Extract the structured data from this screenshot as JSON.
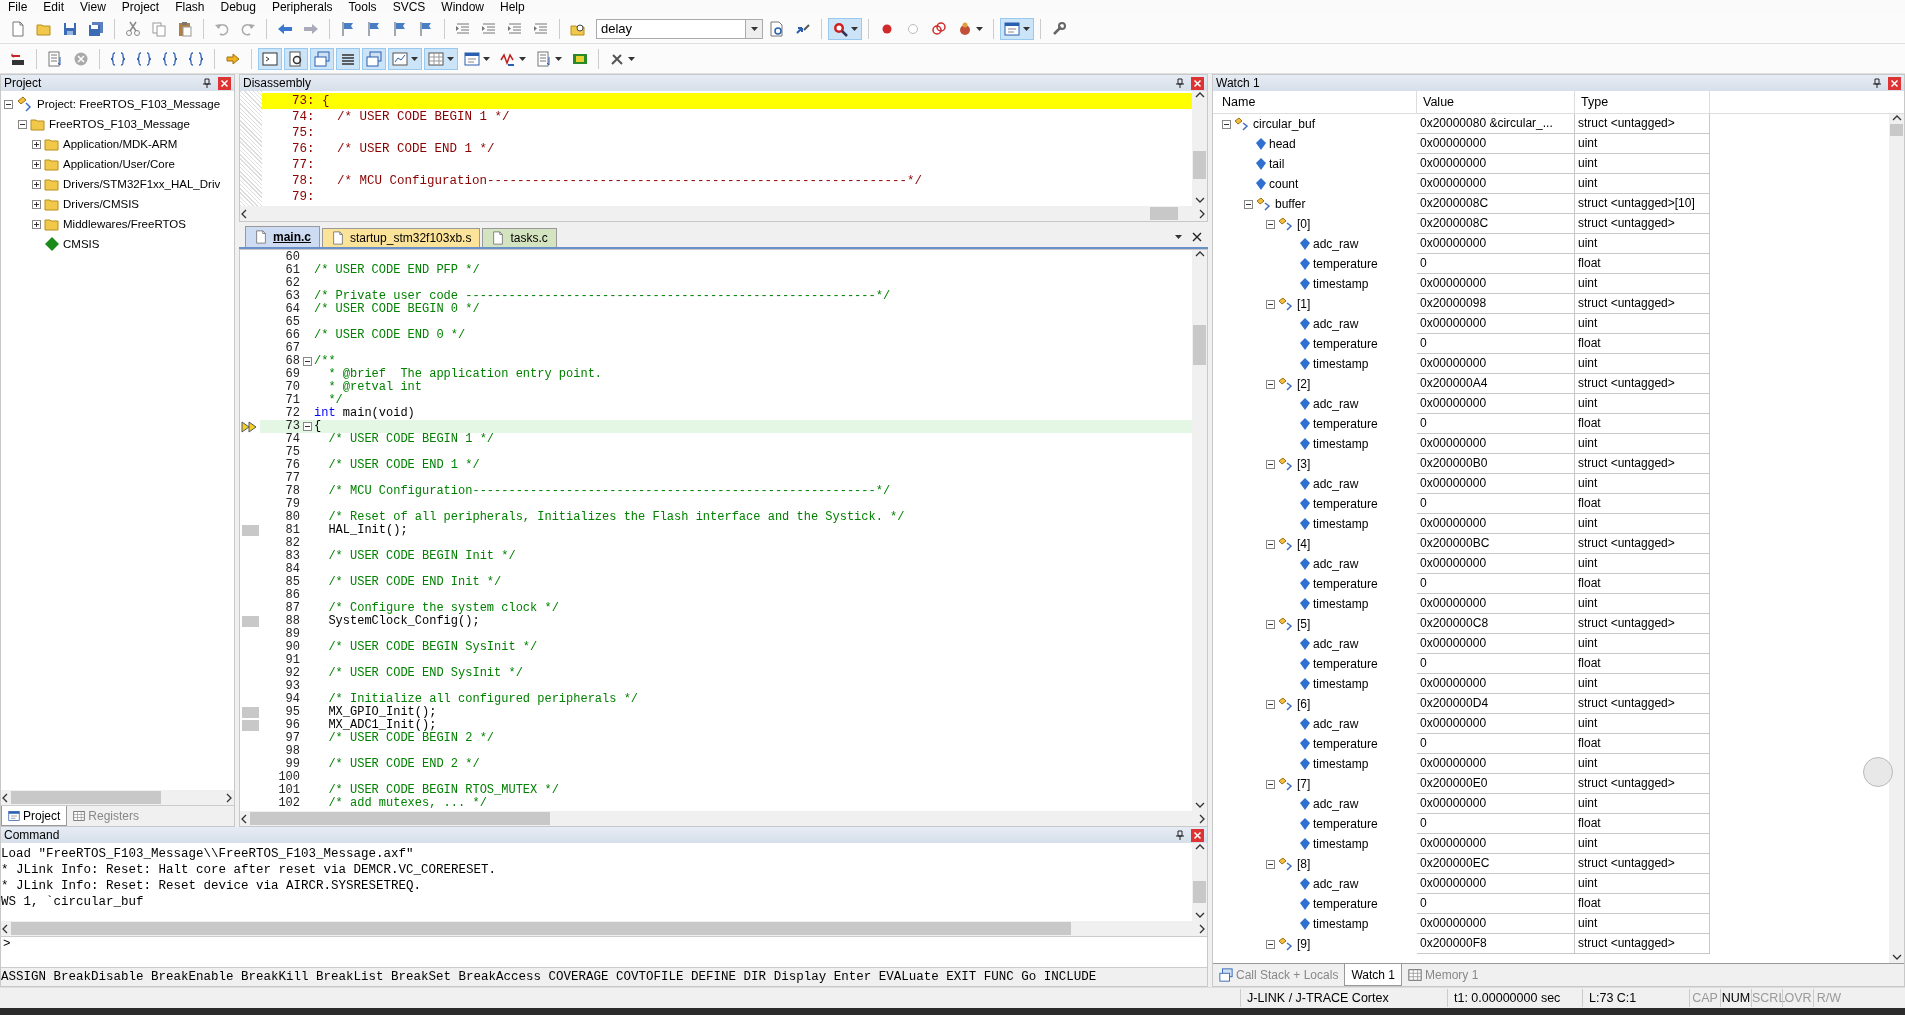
{
  "menu": [
    "File",
    "Edit",
    "View",
    "Project",
    "Flash",
    "Debug",
    "Peripherals",
    "Tools",
    "SVCS",
    "Window",
    "Help"
  ],
  "toolbar_1": [
    {
      "kind": "button",
      "on": false
    },
    {
      "kind": "button",
      "on": false
    },
    {
      "kind": "button",
      "on": false
    },
    {
      "kind": "button",
      "on": false
    },
    {
      "kind": "separator"
    },
    {
      "kind": "button",
      "on": false
    },
    {
      "kind": "button",
      "on": false
    },
    {
      "kind": "button",
      "on": false
    },
    {
      "kind": "separator"
    },
    {
      "kind": "button",
      "on": false
    },
    {
      "kind": "button",
      "on": false
    },
    {
      "kind": "separator"
    },
    {
      "kind": "button",
      "on": false
    },
    {
      "kind": "button",
      "on": false
    },
    {
      "kind": "separator"
    },
    {
      "kind": "button",
      "on": false
    },
    {
      "kind": "button",
      "on": false
    },
    {
      "kind": "button",
      "on": false
    },
    {
      "kind": "button",
      "on": false
    },
    {
      "kind": "separator"
    },
    {
      "kind": "button",
      "on": false
    },
    {
      "kind": "button",
      "on": false
    },
    {
      "kind": "button",
      "on": false
    },
    {
      "kind": "button",
      "on": false
    },
    {
      "kind": "separator"
    },
    {
      "kind": "button",
      "on": false
    },
    {
      "kind": "combo",
      "value": "delay"
    },
    {
      "kind": "button",
      "on": false
    },
    {
      "kind": "button",
      "on": false
    },
    {
      "kind": "separator"
    },
    {
      "kind": "menu-button",
      "on": true
    },
    {
      "kind": "separator"
    },
    {
      "kind": "button",
      "on": false
    },
    {
      "kind": "button",
      "on": false
    },
    {
      "kind": "button",
      "on": false
    },
    {
      "kind": "menu-button",
      "on": false
    },
    {
      "kind": "separator"
    },
    {
      "kind": "menu-button",
      "on": true
    },
    {
      "kind": "separator"
    },
    {
      "kind": "button",
      "on": false
    }
  ],
  "toolbar_2": [
    {
      "kind": "button",
      "on": false
    },
    {
      "kind": "separator"
    },
    {
      "kind": "button",
      "on": false
    },
    {
      "kind": "button",
      "on": false
    },
    {
      "kind": "separator"
    },
    {
      "kind": "button",
      "on": false
    },
    {
      "kind": "button",
      "on": false
    },
    {
      "kind": "button",
      "on": false
    },
    {
      "kind": "button",
      "on": false
    },
    {
      "kind": "separator"
    },
    {
      "kind": "button",
      "on": false
    },
    {
      "kind": "separator"
    },
    {
      "kind": "button",
      "on": true
    },
    {
      "kind": "button",
      "on": true
    },
    {
      "kind": "button",
      "on": true
    },
    {
      "kind": "button",
      "on": true
    },
    {
      "kind": "button",
      "on": true
    },
    {
      "kind": "menu-button",
      "on": true
    },
    {
      "kind": "menu-button",
      "on": true
    },
    {
      "kind": "menu-button",
      "on": false
    },
    {
      "kind": "menu-button",
      "on": false
    },
    {
      "kind": "menu-button",
      "on": false
    },
    {
      "kind": "button",
      "on": false
    },
    {
      "kind": "separator"
    },
    {
      "kind": "menu-button",
      "on": false
    }
  ],
  "project_panel": {
    "title": "Project",
    "tree": [
      {
        "label": "Project: FreeRTOS_F103_Message",
        "kind": "project",
        "expanded": true,
        "children": [
          {
            "label": "FreeRTOS_F103_Message",
            "kind": "target",
            "expanded": true,
            "children": [
              {
                "label": "Application/MDK-ARM",
                "kind": "folder",
                "expanded": false
              },
              {
                "label": "Application/User/Core",
                "kind": "folder",
                "expanded": false
              },
              {
                "label": "Drivers/STM32F1xx_HAL_Driv",
                "kind": "folder",
                "expanded": false
              },
              {
                "label": "Drivers/CMSIS",
                "kind": "folder",
                "expanded": false
              },
              {
                "label": "Middlewares/FreeRTOS",
                "kind": "folder",
                "expanded": false
              },
              {
                "label": "CMSIS",
                "kind": "component"
              }
            ]
          }
        ]
      }
    ],
    "tabs": [
      {
        "label": "Project",
        "selected": true
      },
      {
        "label": "Registers",
        "selected": false
      }
    ]
  },
  "disassembly": {
    "title": "Disassembly",
    "lines": [
      {
        "text": "    73: {",
        "kind": "current"
      },
      {
        "text": "    74:   /* USER CODE BEGIN 1 */",
        "kind": "source"
      },
      {
        "text": "    75: ",
        "kind": "source"
      },
      {
        "text": "    76:   /* USER CODE END 1 */",
        "kind": "source"
      },
      {
        "text": "    77: ",
        "kind": "source"
      },
      {
        "text": "    78:   /* MCU Configuration--------------------------------------------------------*/",
        "kind": "source"
      },
      {
        "text": "    79: ",
        "kind": "source"
      }
    ]
  },
  "editor": {
    "tabs": [
      {
        "label": "main.c",
        "selected": true,
        "color": "#cddcf2"
      },
      {
        "label": "startup_stm32f103xb.s",
        "selected": false,
        "color": "#fbe39a"
      },
      {
        "label": "tasks.c",
        "selected": false,
        "color": "#d5e4c0"
      }
    ],
    "lines": [
      {
        "n": "60",
        "kind": "blank"
      },
      {
        "n": "61",
        "text": "/* USER CODE END PFP */",
        "kind": "comment"
      },
      {
        "n": "62",
        "kind": "blank"
      },
      {
        "n": "63",
        "text": "/* Private user code ---------------------------------------------------------*/",
        "kind": "comment"
      },
      {
        "n": "64",
        "text": "/* USER CODE BEGIN 0 */",
        "kind": "comment"
      },
      {
        "n": "65",
        "kind": "blank"
      },
      {
        "n": "66",
        "text": "/* USER CODE END 0 */",
        "kind": "comment"
      },
      {
        "n": "67",
        "kind": "blank"
      },
      {
        "n": "68",
        "text": "/**",
        "kind": "fold-comment"
      },
      {
        "n": "69",
        "text": "  * @brief  The application entry point.",
        "kind": "comment"
      },
      {
        "n": "70",
        "text": "  * @retval int",
        "kind": "comment"
      },
      {
        "n": "71",
        "text": "  */",
        "kind": "comment"
      },
      {
        "n": "72",
        "keyword": "int",
        "text": " main(void)",
        "kind": "code"
      },
      {
        "n": "73",
        "text": "{",
        "kind": "current"
      },
      {
        "n": "74",
        "text": "  /* USER CODE BEGIN 1 */",
        "kind": "comment"
      },
      {
        "n": "75",
        "kind": "blank"
      },
      {
        "n": "76",
        "text": "  /* USER CODE END 1 */",
        "kind": "comment"
      },
      {
        "n": "77",
        "kind": "blank"
      },
      {
        "n": "78",
        "text": "  /* MCU Configuration--------------------------------------------------------*/",
        "kind": "comment"
      },
      {
        "n": "79",
        "kind": "blank"
      },
      {
        "n": "80",
        "text": "  /* Reset of all peripherals, Initializes the Flash interface and the Systick. */",
        "kind": "comment"
      },
      {
        "n": "81",
        "text": "  HAL_Init();",
        "kind": "exec"
      },
      {
        "n": "82",
        "kind": "blank"
      },
      {
        "n": "83",
        "text": "  /* USER CODE BEGIN Init */",
        "kind": "comment"
      },
      {
        "n": "84",
        "kind": "blank"
      },
      {
        "n": "85",
        "text": "  /* USER CODE END Init */",
        "kind": "comment"
      },
      {
        "n": "86",
        "kind": "blank"
      },
      {
        "n": "87",
        "text": "  /* Configure the system clock */",
        "kind": "comment"
      },
      {
        "n": "88",
        "text": "  SystemClock_Config();",
        "kind": "exec"
      },
      {
        "n": "89",
        "kind": "blank"
      },
      {
        "n": "90",
        "text": "  /* USER CODE BEGIN SysInit */",
        "kind": "comment"
      },
      {
        "n": "91",
        "kind": "blank"
      },
      {
        "n": "92",
        "text": "  /* USER CODE END SysInit */",
        "kind": "comment"
      },
      {
        "n": "93",
        "kind": "blank"
      },
      {
        "n": "94",
        "text": "  /* Initialize all configured peripherals */",
        "kind": "comment"
      },
      {
        "n": "95",
        "text": "  MX_GPIO_Init();",
        "kind": "exec"
      },
      {
        "n": "96",
        "text": "  MX_ADC1_Init();",
        "kind": "exec"
      },
      {
        "n": "97",
        "text": "  /* USER CODE BEGIN 2 */",
        "kind": "comment"
      },
      {
        "n": "98",
        "kind": "blank"
      },
      {
        "n": "99",
        "text": "  /* USER CODE END 2 */",
        "kind": "comment"
      },
      {
        "n": "100",
        "kind": "blank"
      },
      {
        "n": "101",
        "text": "  /* USER CODE BEGIN RTOS_MUTEX */",
        "kind": "comment"
      },
      {
        "n": "102",
        "text": "  /* add mutexes, ... */",
        "kind": "comment"
      }
    ]
  },
  "watch": {
    "title": "Watch 1",
    "columns": [
      "Name",
      "Value",
      "Type"
    ],
    "rows": [
      {
        "name": "circular_buf",
        "value": "0x20000080 &circular_...",
        "type": "struct <untagged>",
        "expanded": true,
        "children": [
          {
            "name": "head",
            "value": "0x00000000",
            "type": "uint"
          },
          {
            "name": "tail",
            "value": "0x00000000",
            "type": "uint"
          },
          {
            "name": "count",
            "value": "0x00000000",
            "type": "uint"
          },
          {
            "name": "buffer",
            "value": "0x2000008C",
            "type": "struct <untagged>[10]",
            "expanded": true,
            "children": [
              {
                "name": "[0]",
                "value": "0x2000008C",
                "type": "struct <untagged>",
                "expanded": true,
                "children": [
                  {
                    "name": "adc_raw",
                    "value": "0x00000000",
                    "type": "uint"
                  },
                  {
                    "name": "temperature",
                    "value": "0",
                    "type": "float"
                  },
                  {
                    "name": "timestamp",
                    "value": "0x00000000",
                    "type": "uint"
                  }
                ]
              },
              {
                "name": "[1]",
                "value": "0x20000098",
                "type": "struct <untagged>",
                "expanded": true,
                "children": [
                  {
                    "name": "adc_raw",
                    "value": "0x00000000",
                    "type": "uint"
                  },
                  {
                    "name": "temperature",
                    "value": "0",
                    "type": "float"
                  },
                  {
                    "name": "timestamp",
                    "value": "0x00000000",
                    "type": "uint"
                  }
                ]
              },
              {
                "name": "[2]",
                "value": "0x200000A4",
                "type": "struct <untagged>",
                "expanded": true,
                "children": [
                  {
                    "name": "adc_raw",
                    "value": "0x00000000",
                    "type": "uint"
                  },
                  {
                    "name": "temperature",
                    "value": "0",
                    "type": "float"
                  },
                  {
                    "name": "timestamp",
                    "value": "0x00000000",
                    "type": "uint"
                  }
                ]
              },
              {
                "name": "[3]",
                "value": "0x200000B0",
                "type": "struct <untagged>",
                "expanded": true,
                "children": [
                  {
                    "name": "adc_raw",
                    "value": "0x00000000",
                    "type": "uint"
                  },
                  {
                    "name": "temperature",
                    "value": "0",
                    "type": "float"
                  },
                  {
                    "name": "timestamp",
                    "value": "0x00000000",
                    "type": "uint"
                  }
                ]
              },
              {
                "name": "[4]",
                "value": "0x200000BC",
                "type": "struct <untagged>",
                "expanded": true,
                "children": [
                  {
                    "name": "adc_raw",
                    "value": "0x00000000",
                    "type": "uint"
                  },
                  {
                    "name": "temperature",
                    "value": "0",
                    "type": "float"
                  },
                  {
                    "name": "timestamp",
                    "value": "0x00000000",
                    "type": "uint"
                  }
                ]
              },
              {
                "name": "[5]",
                "value": "0x200000C8",
                "type": "struct <untagged>",
                "expanded": true,
                "children": [
                  {
                    "name": "adc_raw",
                    "value": "0x00000000",
                    "type": "uint"
                  },
                  {
                    "name": "temperature",
                    "value": "0",
                    "type": "float"
                  },
                  {
                    "name": "timestamp",
                    "value": "0x00000000",
                    "type": "uint"
                  }
                ]
              },
              {
                "name": "[6]",
                "value": "0x200000D4",
                "type": "struct <untagged>",
                "expanded": true,
                "children": [
                  {
                    "name": "adc_raw",
                    "value": "0x00000000",
                    "type": "uint"
                  },
                  {
                    "name": "temperature",
                    "value": "0",
                    "type": "float"
                  },
                  {
                    "name": "timestamp",
                    "value": "0x00000000",
                    "type": "uint"
                  }
                ]
              },
              {
                "name": "[7]",
                "value": "0x200000E0",
                "type": "struct <untagged>",
                "expanded": true,
                "children": [
                  {
                    "name": "adc_raw",
                    "value": "0x00000000",
                    "type": "uint"
                  },
                  {
                    "name": "temperature",
                    "value": "0",
                    "type": "float"
                  },
                  {
                    "name": "timestamp",
                    "value": "0x00000000",
                    "type": "uint"
                  }
                ]
              },
              {
                "name": "[8]",
                "value": "0x200000EC",
                "type": "struct <untagged>",
                "expanded": true,
                "children": [
                  {
                    "name": "adc_raw",
                    "value": "0x00000000",
                    "type": "uint"
                  },
                  {
                    "name": "temperature",
                    "value": "0",
                    "type": "float"
                  },
                  {
                    "name": "timestamp",
                    "value": "0x00000000",
                    "type": "uint"
                  }
                ]
              },
              {
                "name": "[9]",
                "value": "0x200000F8",
                "type": "struct <untagged>",
                "expanded": true
              }
            ]
          }
        ]
      }
    ],
    "tabs": [
      {
        "label": "Call Stack + Locals",
        "selected": false
      },
      {
        "label": "Watch 1",
        "selected": true
      },
      {
        "label": "Memory 1",
        "selected": false
      }
    ]
  },
  "command": {
    "title": "Command",
    "lines": [
      "Load \"FreeRTOS_F103_Message\\\\FreeRTOS_F103_Message.axf\"",
      "* JLink Info: Reset: Halt core after reset via DEMCR.VC_CORERESET.",
      "* JLink Info: Reset: Reset device via AIRCR.SYSRESETREQ.",
      "WS 1, `circular_buf"
    ],
    "prompt": ">",
    "hint": "ASSIGN BreakDisable BreakEnable BreakKill BreakList BreakSet BreakAccess COVERAGE COVTOFILE DEFINE DIR Display Enter EVALuate EXIT FUNC Go INCLUDE"
  },
  "status_bar": {
    "items": [
      "J-LINK / J-TRACE Cortex",
      "t1: 0.00000000 sec",
      "L:73 C:1"
    ],
    "indicators": [
      {
        "label": "CAP",
        "on": false
      },
      {
        "label": "NUM",
        "on": true
      },
      {
        "label": "SCRL",
        "on": false
      },
      {
        "label": "OVR",
        "on": false
      },
      {
        "label": "R/W",
        "on": false
      }
    ]
  }
}
